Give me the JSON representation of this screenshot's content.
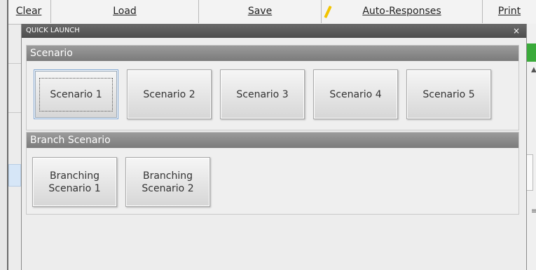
{
  "toolbar": {
    "clear": "Clear",
    "load": "Load",
    "save": "Save",
    "auto_responses": "Auto-Responses",
    "print": "Print"
  },
  "window": {
    "title": "QUICK LAUNCH",
    "close": "×"
  },
  "scenario_section": {
    "header": "Scenario",
    "buttons": [
      "Scenario 1",
      "Scenario 2",
      "Scenario 3",
      "Scenario 4",
      "Scenario 5"
    ]
  },
  "branch_section": {
    "header": "Branch Scenario",
    "buttons": [
      "Branching\nScenario 1",
      "Branching\nScenario 2"
    ]
  },
  "colors": {
    "title_bar": "#4d4d4d",
    "section_header": "#8a8a8a",
    "accent_green": "#3aaa3a",
    "pencil": "#f2c400"
  }
}
